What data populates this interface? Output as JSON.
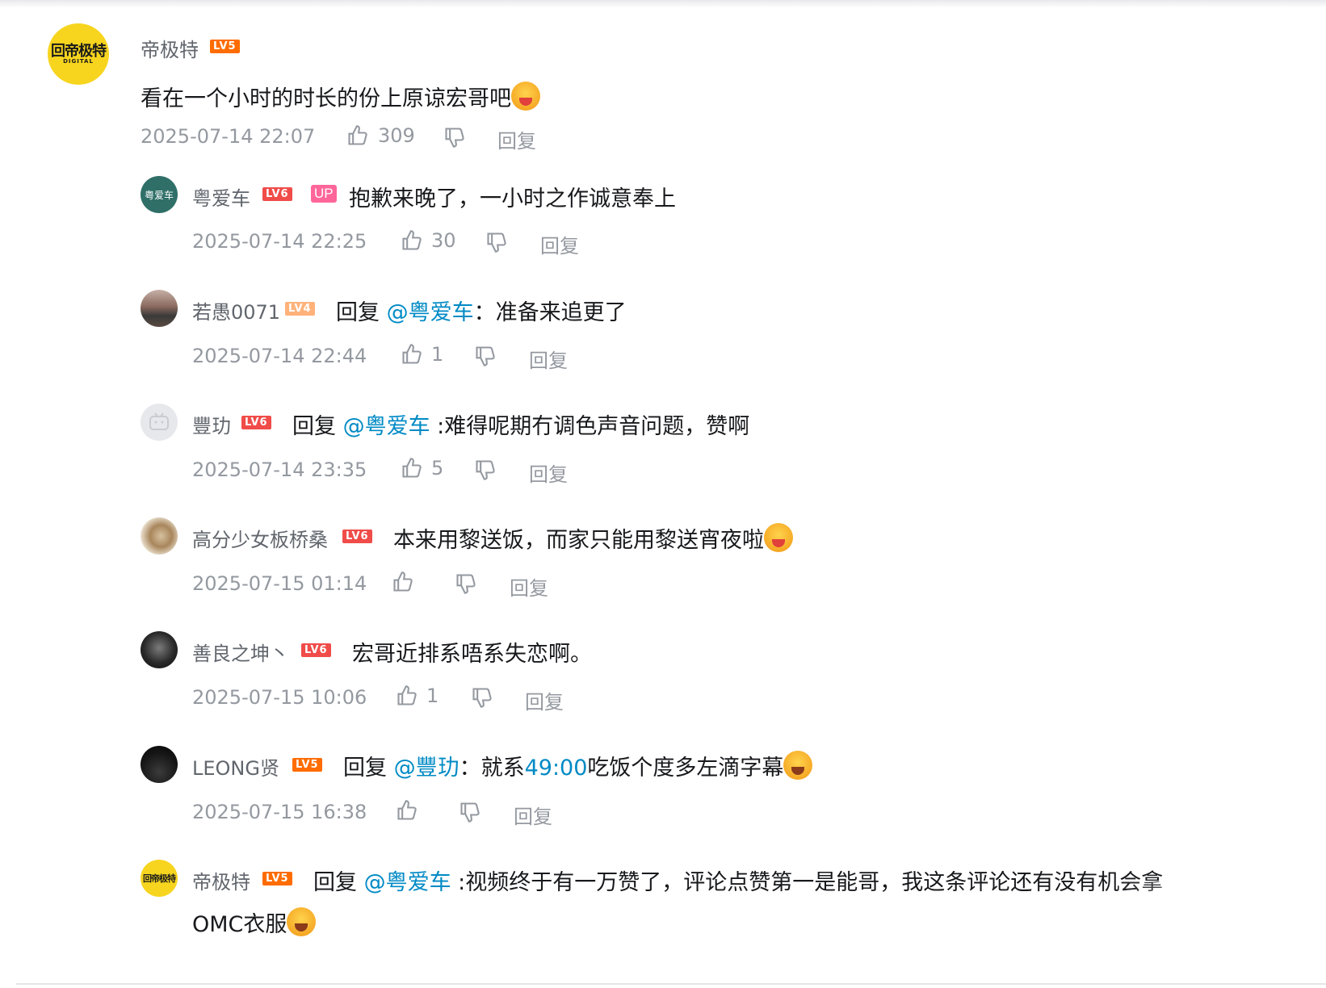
{
  "main_comment": {
    "username": "帝极特",
    "level": "LV5",
    "avatar_text": "回帝极特",
    "avatar_sub": "DIGITAL",
    "content": "看在一个小时的时长的份上原谅宏哥吧",
    "timestamp": "2025-07-14 22:07",
    "likes": "309",
    "reply_label": "回复"
  },
  "replies": [
    {
      "username": "粤爱车",
      "level": "LV6",
      "up_tag": "UP",
      "content": "抱歉来晚了，一小时之作诚意奉上",
      "timestamp": "2025-07-14 22:25",
      "likes": "30",
      "reply_label": "回复"
    },
    {
      "username": "若愚0071",
      "level": "LV4",
      "reply_prefix": "回复",
      "mention": "@粤爱车",
      "content": "：准备来追更了",
      "timestamp": "2025-07-14 22:44",
      "likes": "1",
      "reply_label": "回复"
    },
    {
      "username": "豐玏",
      "level": "LV6",
      "reply_prefix": "回复",
      "mention": "@粤爱车",
      "content": " :难得呢期冇调色声音问题，赞啊",
      "timestamp": "2025-07-14 23:35",
      "likes": "5",
      "reply_label": "回复"
    },
    {
      "username": "高分少女板桥桑",
      "level": "LV6",
      "content": "本来用黎送饭，而家只能用黎送宵夜啦",
      "timestamp": "2025-07-15 01:14",
      "likes": "",
      "reply_label": "回复"
    },
    {
      "username": "善良之坤丶",
      "level": "LV6",
      "content": "宏哥近排系唔系失恋啊。",
      "timestamp": "2025-07-15 10:06",
      "likes": "1",
      "reply_label": "回复"
    },
    {
      "username": "LEONG贤",
      "level": "LV5",
      "reply_prefix": "回复",
      "mention": "@豐玏",
      "content_a": "：就系",
      "content_time": "49:00",
      "content_b": "吃饭个度多左滴字幕",
      "timestamp": "2025-07-15 16:38",
      "likes": "",
      "reply_label": "回复"
    },
    {
      "username": "帝极特",
      "level": "LV5",
      "reply_prefix": "回复",
      "mention": "@粤爱车",
      "content": " :视频终于有一万赞了，评论点赞第一是能哥，我这条评论还有没有机会拿",
      "content_line2": "OMC衣服"
    }
  ],
  "colors": {
    "mention": "#008ac5",
    "meta": "#9499a0",
    "up_tag": "#ff6699",
    "lv5": "#ff6c00",
    "lv6": "#f04c49"
  },
  "icons": [
    "like-icon",
    "dislike-icon"
  ]
}
